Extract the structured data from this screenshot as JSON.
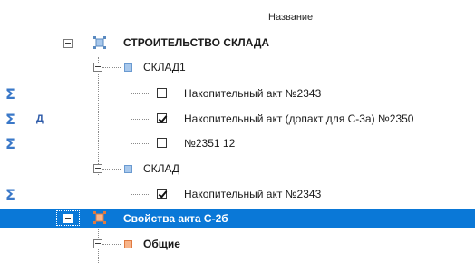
{
  "header": {
    "column_title": "Название"
  },
  "tree": {
    "root": {
      "label": "СТРОИТЕЛЬСТВО СКЛАДА"
    },
    "warehouse1": {
      "label": "СКЛАД1",
      "items": [
        {
          "label": "Накопительный акт №2343",
          "checked": false
        },
        {
          "label": "Накопительный акт (допакт для С-3а) №2350",
          "checked": true
        },
        {
          "label": "№2351 12",
          "checked": false
        }
      ]
    },
    "warehouse2": {
      "label": "СКЛАД",
      "items": [
        {
          "label": "Накопительный акт №2343",
          "checked": true
        }
      ]
    },
    "act_properties": {
      "label": "Свойства акта С-2б"
    },
    "general": {
      "label": "Общие"
    }
  },
  "gutter": {
    "sigma": "Σ",
    "d_marker": "Д"
  },
  "colors": {
    "selection": "#0a78d7",
    "sigma": "#3a78c8",
    "icon_blue": "#a8c8ec",
    "icon_orange": "#f7b48a"
  }
}
